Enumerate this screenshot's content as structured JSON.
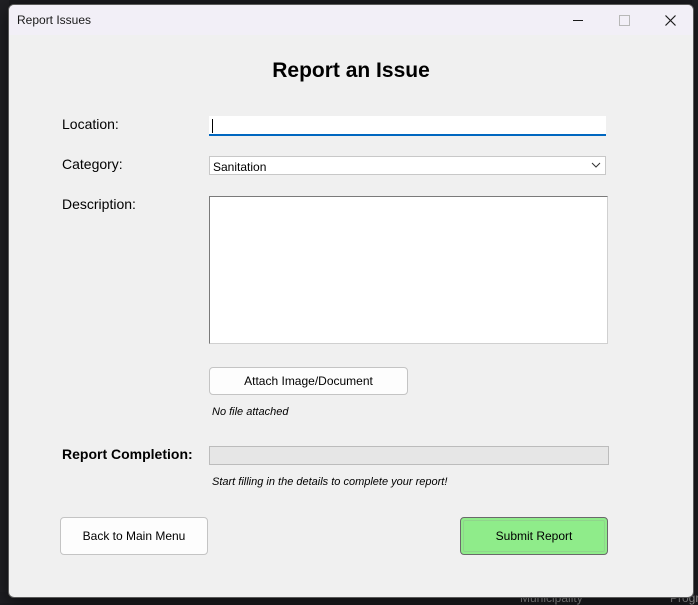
{
  "window": {
    "title": "Report Issues"
  },
  "heading": "Report an Issue",
  "form": {
    "location_label": "Location:",
    "location_value": "",
    "category_label": "Category:",
    "category_value": "Sanitation",
    "description_label": "Description:",
    "description_value": "",
    "attach_button_label": "Attach Image/Document",
    "attachment_status": "No file attached",
    "completion_label": "Report Completion:",
    "completion_progress": 0,
    "completion_hint": "Start filling in the details to complete your report!"
  },
  "buttons": {
    "back_label": "Back to Main Menu",
    "submit_label": "Submit Report"
  },
  "background": {
    "bottom_text_1": "Municipality",
    "bottom_text_2": "Progr"
  },
  "colors": {
    "submit_bg": "#8fec8a",
    "input_focus_underline": "#0067c0",
    "window_bg": "#f0f0f0"
  }
}
